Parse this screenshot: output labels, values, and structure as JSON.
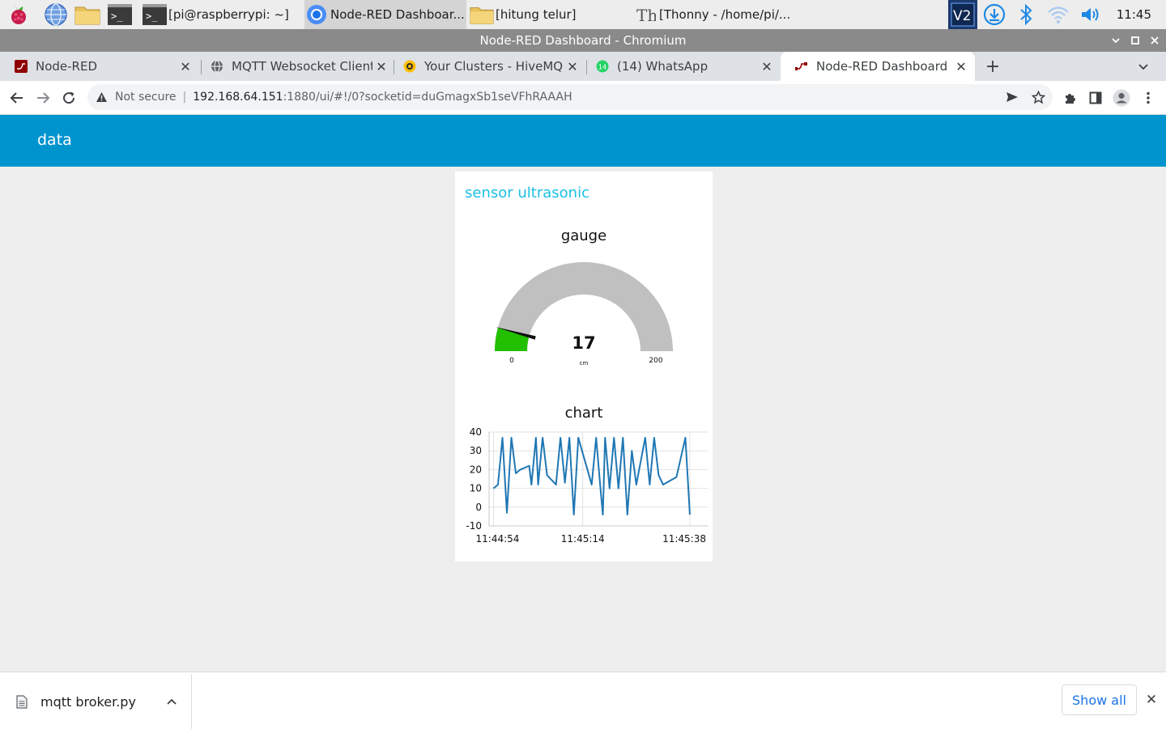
{
  "taskbar": {
    "tasks": [
      {
        "label": "[pi@raspberrypi: ~]",
        "icon": "terminal-icon"
      },
      {
        "label": "Node-RED Dashboar...",
        "icon": "chromium-icon",
        "active": true
      },
      {
        "label": "[hitung telur]",
        "icon": "folder-icon"
      },
      {
        "label": "[Thonny  -  /home/pi/...",
        "icon": "thonny-icon"
      }
    ],
    "clock": "11:45"
  },
  "window": {
    "title": "Node-RED Dashboard - Chromium"
  },
  "tabs": [
    {
      "label": "Node-RED",
      "icon": "node-red-icon",
      "color": "#8f0000"
    },
    {
      "label": "MQTT Websocket Client",
      "icon": "globe-icon",
      "color": "#5f6368"
    },
    {
      "label": "Your Clusters - HiveMQ C",
      "icon": "hivemq-icon",
      "color": "#ffc000"
    },
    {
      "label": "(14) WhatsApp",
      "icon": "whatsapp-icon",
      "color": "#25d366",
      "badge": "14"
    },
    {
      "label": "Node-RED Dashboard",
      "icon": "node-red-dashboard-icon",
      "color": "#8f0000",
      "active": true
    }
  ],
  "toolbar": {
    "not_secure": "Not secure",
    "url_host": "192.168.64.151",
    "url_path": ":1880/ui/#!/0?socketid=duGmagxSb1seVFhRAAAH"
  },
  "dashboard": {
    "header_title": "data",
    "group_title": "sensor ultrasonic",
    "gauge": {
      "title": "gauge",
      "value": "17",
      "value_num": 17,
      "units": "cm",
      "min": "0",
      "max": "200",
      "min_num": 0,
      "max_num": 200,
      "fill_color": "#22c000",
      "track_color": "#c0c0c0"
    },
    "chart_title": "chart"
  },
  "chart_data": {
    "type": "line",
    "ylim": [
      -10,
      40
    ],
    "yticks": [
      "40",
      "30",
      "20",
      "10",
      "0",
      "-10"
    ],
    "xticks": [
      "11:44:54",
      "11:45:14",
      "11:45:38"
    ],
    "xtick_seconds": [
      0,
      20,
      44
    ],
    "xlim_seconds": [
      -1,
      48
    ],
    "grid": true,
    "color": "#1f77b4",
    "x": [
      0,
      1,
      2,
      3,
      4,
      5,
      6,
      8,
      8.5,
      9.5,
      10,
      11,
      12,
      14,
      15,
      16,
      17,
      18,
      19,
      22,
      23,
      24,
      24.5,
      25,
      26,
      27,
      28,
      29,
      30,
      31,
      32,
      34,
      35,
      36,
      37,
      38,
      41,
      43,
      44
    ],
    "y": [
      10,
      12,
      37,
      -3,
      37,
      18,
      20,
      22,
      12,
      37,
      12,
      37,
      17,
      12,
      37,
      13,
      37,
      -4,
      37,
      12,
      37,
      9,
      -4,
      37,
      10,
      37,
      10,
      37,
      -4,
      30,
      12,
      37,
      12,
      37,
      17,
      12,
      16,
      37,
      -4
    ]
  },
  "downloads": {
    "file_name": "mqtt broker.py",
    "show_all": "Show all"
  }
}
